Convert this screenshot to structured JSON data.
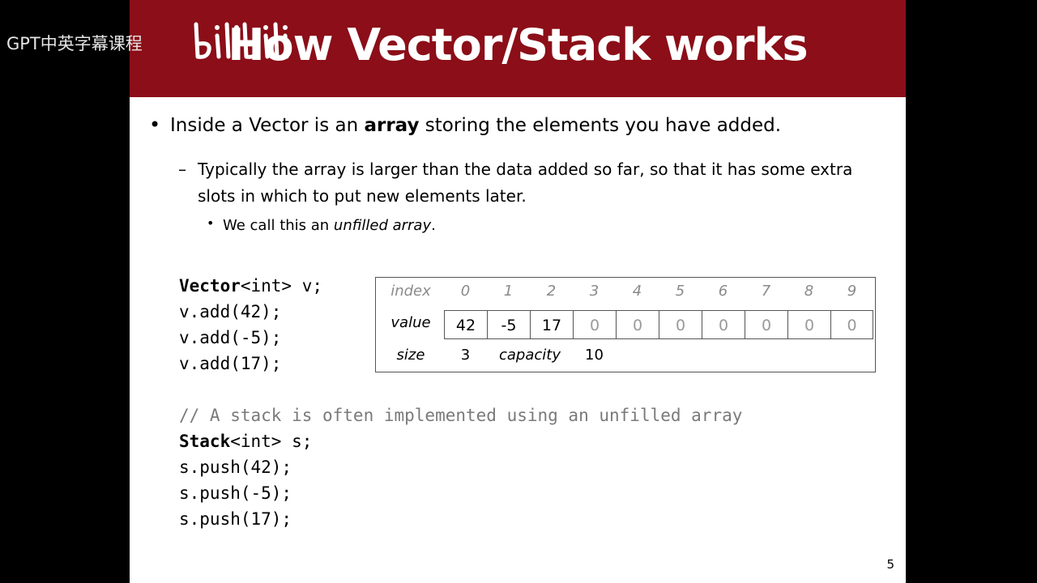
{
  "watermark": {
    "text": "GPT中英字幕课程",
    "logo_text": "bilibili"
  },
  "slide": {
    "title": "How Vector/Stack works",
    "page_number": "5",
    "bullets": {
      "l1": {
        "before": "Inside a Vector is an ",
        "bold": "array",
        "after": " storing the elements you have added."
      },
      "l2_marker": "–",
      "l2": "Typically the array is larger than the data added so far, so that it has some extra slots in which to put new elements later.",
      "l3": {
        "before": "We call this an ",
        "italic": "unfilled array",
        "after": "."
      }
    },
    "code1": [
      {
        "kw": "Vector",
        "rest": "<int> v;"
      },
      {
        "kw": "",
        "rest": "v.add(42);"
      },
      {
        "kw": "",
        "rest": "v.add(-5);"
      },
      {
        "kw": "",
        "rest": "v.add(17);"
      }
    ],
    "code2": {
      "comment": "// A stack is often implemented using an unfilled array",
      "lines": [
        {
          "kw": "Stack",
          "rest": "<int> s;"
        },
        {
          "kw": "",
          "rest": "s.push(42);"
        },
        {
          "kw": "",
          "rest": "s.push(-5);"
        },
        {
          "kw": "",
          "rest": "s.push(17);"
        }
      ]
    },
    "array": {
      "index_label": "index",
      "value_label": "value",
      "size_label": "size",
      "capacity_label": "capacity",
      "indices": [
        "0",
        "1",
        "2",
        "3",
        "4",
        "5",
        "6",
        "7",
        "8",
        "9"
      ],
      "values": [
        "42",
        "-5",
        "17",
        "0",
        "0",
        "0",
        "0",
        "0",
        "0",
        "0"
      ],
      "size": "3",
      "capacity": "10"
    }
  },
  "colors": {
    "title_bar": "#8b0e18",
    "background": "#000000"
  }
}
